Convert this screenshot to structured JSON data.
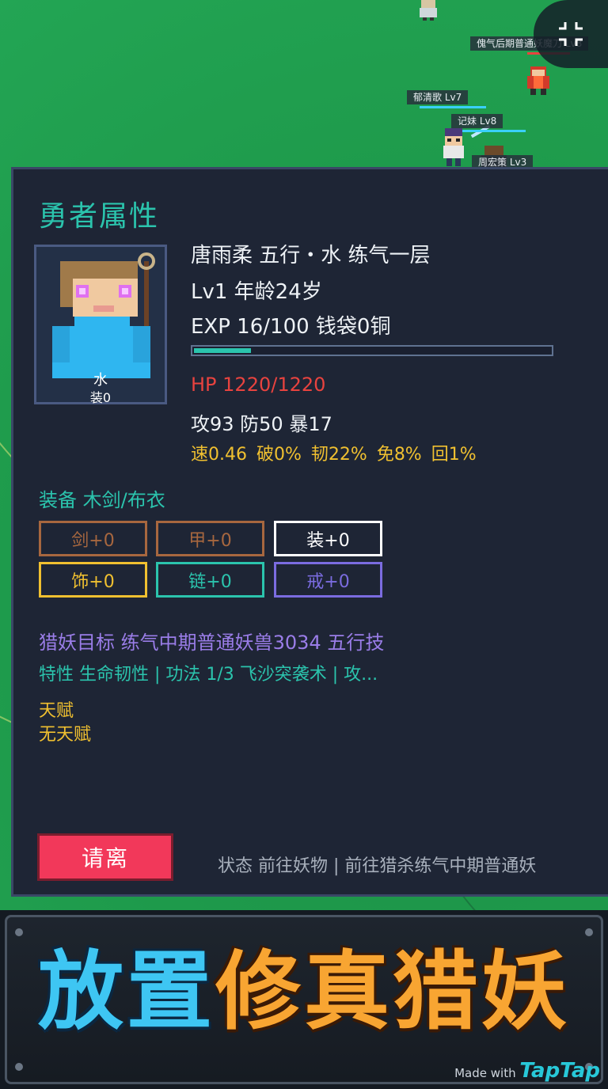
{
  "map": {
    "npcs": [
      {
        "tag": "傀气后期普通妖魔刀 Lv8"
      },
      {
        "tag": "郁清歌 Lv7"
      },
      {
        "tag": "记妹 Lv8"
      },
      {
        "tag": "周宏策 Lv3"
      }
    ]
  },
  "panel": {
    "title": "勇者属性",
    "avatar_element": "水",
    "avatar_equip": "装0",
    "name_line": "唐雨柔 五行・水 练气一层",
    "level_line": "Lv1 年龄24岁",
    "exp_line": "EXP 16/100 钱袋0铜",
    "exp_progress": 0.16,
    "hp_line": "HP 1220/1220",
    "combat_line": "攻93 防50 暴17",
    "sub_stats": [
      "速0.46",
      "破0%",
      "韧22%",
      "免8%",
      "回1%"
    ],
    "equip_label": "装备 木剑/布衣",
    "slots": [
      {
        "label": "剑+0",
        "color": "#a7673f"
      },
      {
        "label": "甲+0",
        "color": "#a7673f"
      },
      {
        "label": "装+0",
        "color": "#ffffff"
      },
      {
        "label": "饰+0",
        "color": "#f0c030"
      },
      {
        "label": "链+0",
        "color": "#2bc4ad"
      },
      {
        "label": "戒+0",
        "color": "#7b6ce0"
      }
    ],
    "hunt_line": "猎妖目标 练气中期普通妖兽3034 五行技",
    "trait_line": "特性 生命韧性 | 功法 1/3 飞沙突袭术 | 攻...",
    "talent_title": "天赋",
    "talent_value": "无天赋",
    "dismiss_label": "请离",
    "status_line": "状态 前往妖物 | 前往猎杀练气中期普通妖"
  },
  "banner": {
    "title_blue": "放置",
    "title_orange": "修真猎妖",
    "made_with_prefix": "Made with",
    "made_with_brand": "TapTap"
  }
}
